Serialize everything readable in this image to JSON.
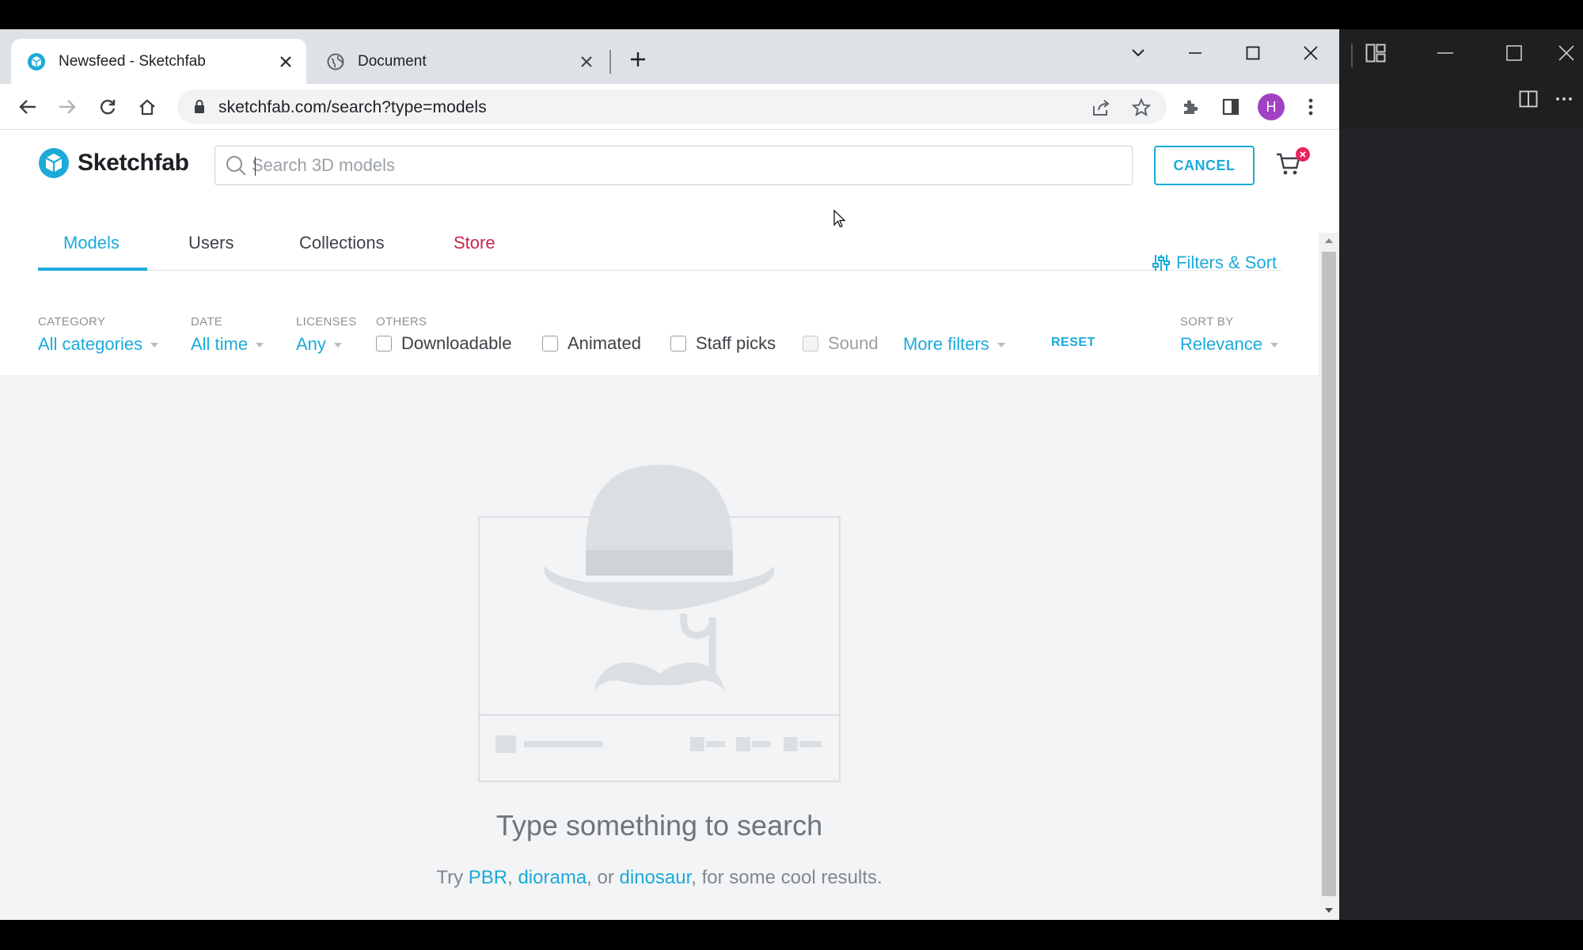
{
  "browser": {
    "tabs": [
      {
        "title": "Newsfeed - Sketchfab",
        "active": true,
        "favicon": "sketchfab-logo-icon"
      },
      {
        "title": "Document",
        "active": false,
        "favicon": "globe-icon"
      }
    ],
    "url": "sketchfab.com/search?type=models",
    "profile_initial": "H",
    "colors": {
      "tabstrip": "#dee1e6",
      "omnibox": "#f1f3f4",
      "avatar": "#a142c5"
    }
  },
  "site": {
    "logo_text": "Sketchfab",
    "search_placeholder": "Search 3D models",
    "search_value": "",
    "cancel_label": "CANCEL",
    "cart_badge": "",
    "colors": {
      "accent": "#1caad9",
      "store": "#c8264d",
      "badge": "#e9245c"
    }
  },
  "nav": {
    "tabs": [
      "Models",
      "Users",
      "Collections",
      "Store"
    ],
    "active_tab": "Models",
    "filters_sort_label": "Filters & Sort"
  },
  "filters": {
    "category": {
      "label": "CATEGORY",
      "value": "All categories"
    },
    "date": {
      "label": "DATE",
      "value": "All time"
    },
    "licenses": {
      "label": "LICENSES",
      "value": "Any"
    },
    "others": {
      "label": "OTHERS",
      "options": [
        {
          "label": "Downloadable",
          "checked": false,
          "disabled": false
        },
        {
          "label": "Animated",
          "checked": false,
          "disabled": false
        },
        {
          "label": "Staff picks",
          "checked": false,
          "disabled": false
        },
        {
          "label": "Sound",
          "checked": false,
          "disabled": true
        }
      ]
    },
    "more_filters_label": "More filters",
    "reset_label": "RESET",
    "sort_by": {
      "label": "SORT BY",
      "value": "Relevance"
    }
  },
  "empty_state": {
    "title": "Type something to search",
    "hint_prefix": "Try ",
    "suggestions": [
      "PBR",
      "diorama",
      "dinosaur"
    ],
    "sep1": ", ",
    "sep2": ", or ",
    "hint_suffix": ", for some cool results."
  }
}
